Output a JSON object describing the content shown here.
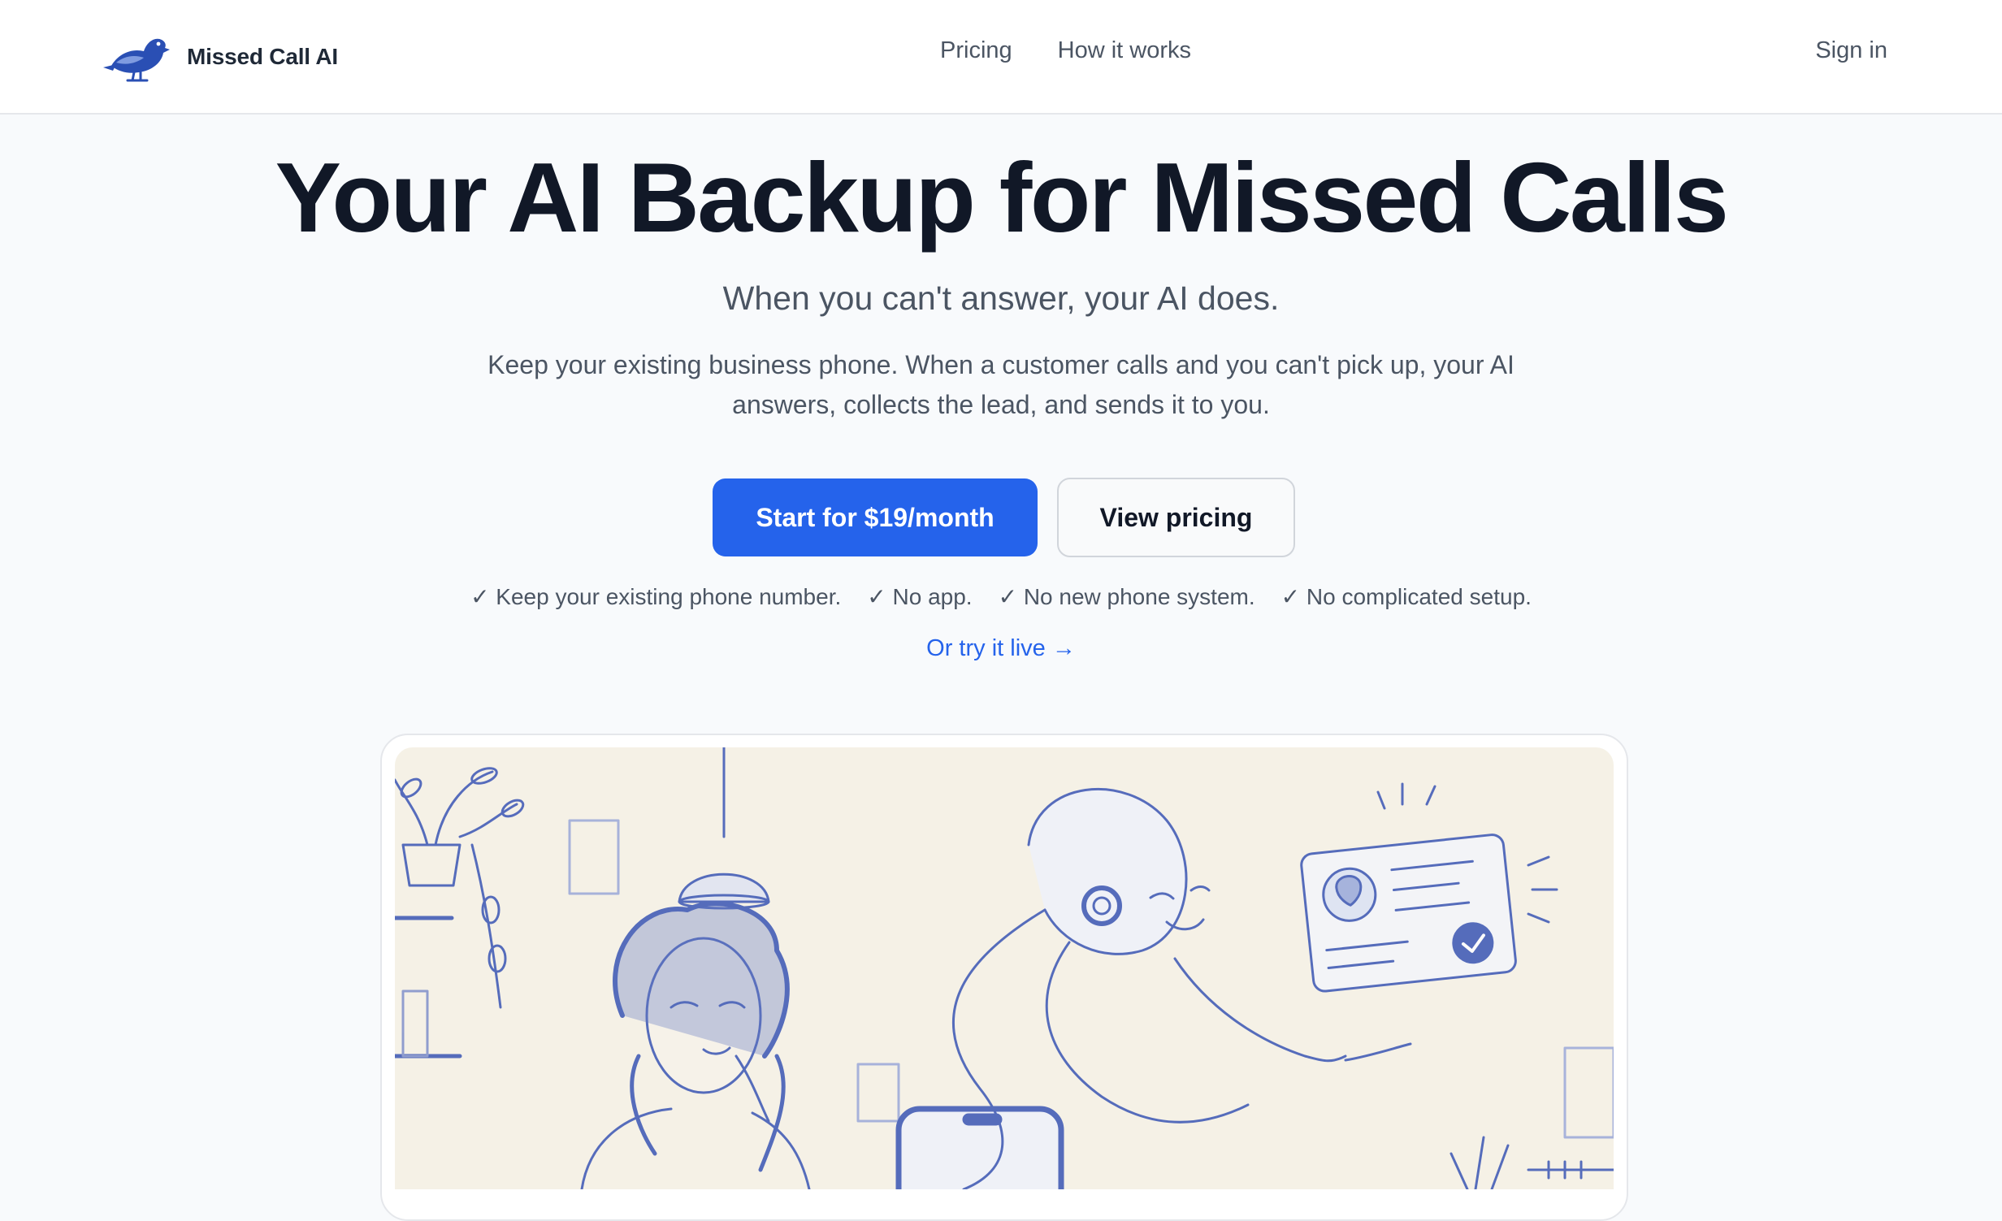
{
  "brand": {
    "name": "Missed Call AI",
    "logo_icon": "bird-icon"
  },
  "nav": {
    "links": [
      {
        "label": "Pricing"
      },
      {
        "label": "How it works"
      }
    ],
    "signin_label": "Sign in"
  },
  "hero": {
    "title": "Your AI Backup for Missed Calls",
    "subtitle": "When you can't answer, your AI does.",
    "description": "Keep your existing business phone. When a customer calls and you can't pick up, your AI answers, collects the lead, and sends it to you.",
    "primary_cta": "Start for $19/month",
    "secondary_cta": "View pricing",
    "checks": [
      "✓ Keep your existing phone number.",
      "✓ No app.",
      "✓ No new phone system.",
      "✓ No complicated setup."
    ],
    "try_live": "Or try it live →"
  },
  "colors": {
    "accent": "#2563eb",
    "heading": "#111827",
    "muted": "#4b5563",
    "illustration_ink": "#3a55b4"
  }
}
